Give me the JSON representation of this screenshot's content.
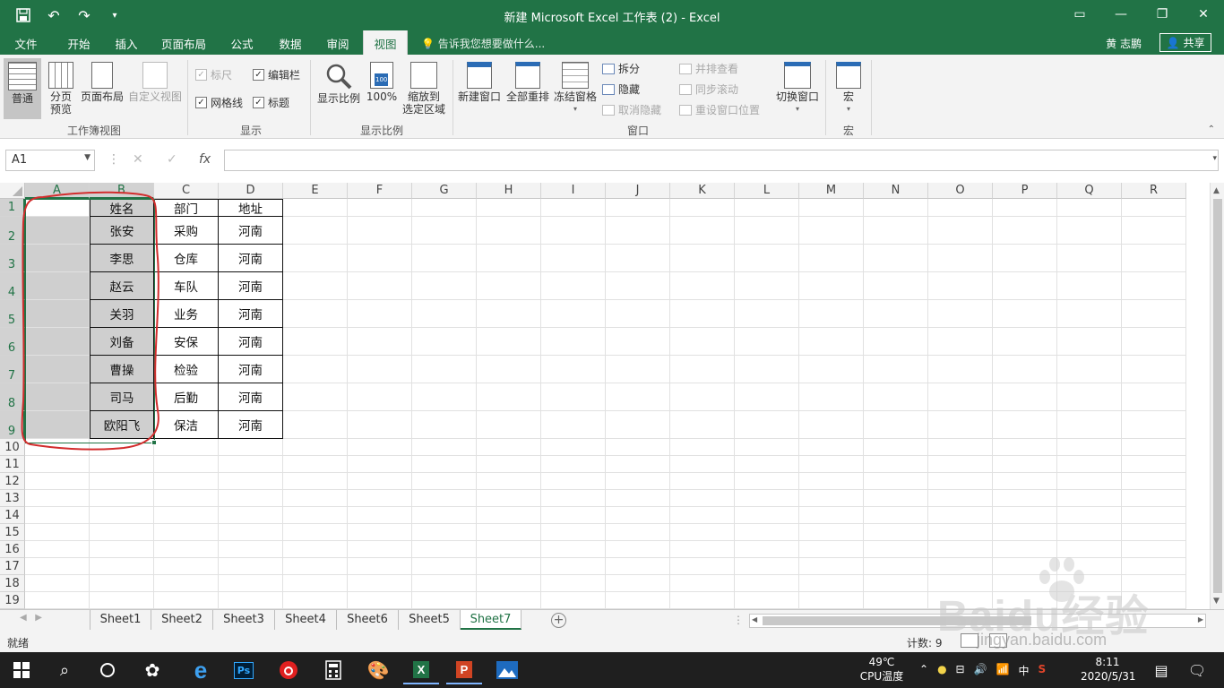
{
  "window": {
    "title": "新建 Microsoft Excel 工作表 (2) - Excel"
  },
  "ribbon_tabs": [
    "文件",
    "开始",
    "插入",
    "页面布局",
    "公式",
    "数据",
    "审阅",
    "视图"
  ],
  "active_tab": "视图",
  "tell_me": "告诉我您想要做什么...",
  "user": "黄 志鹏",
  "share_label": "共享",
  "ribbon": {
    "workbook_views": {
      "label": "工作簿视图",
      "normal": "普通",
      "page_break_1": "分页",
      "page_break_2": "预览",
      "page_layout": "页面布局",
      "custom_views": "自定义视图"
    },
    "show": {
      "label": "显示",
      "ruler": "标尺",
      "formula_bar": "编辑栏",
      "gridlines": "网格线",
      "headings": "标题"
    },
    "zoom": {
      "label": "显示比例",
      "zoom": "显示比例",
      "hundred": "100%",
      "zoom_sel_1": "缩放到",
      "zoom_sel_2": "选定区域",
      "hundred_icon_text": "100"
    },
    "window": {
      "label": "窗口",
      "new_window": "新建窗口",
      "arrange_all": "全部重排",
      "freeze_panes": "冻结窗格",
      "split": "拆分",
      "hide": "隐藏",
      "unhide": "取消隐藏",
      "side_by_side": "并排查看",
      "sync_scroll": "同步滚动",
      "reset_pos": "重设窗口位置",
      "switch_windows": "切换窗口"
    },
    "macros": {
      "label": "宏",
      "macros": "宏"
    }
  },
  "formula_bar": {
    "name_box": "A1",
    "fx": "fx",
    "formula": ""
  },
  "columns": [
    "A",
    "B",
    "C",
    "D",
    "E",
    "F",
    "G",
    "H",
    "I",
    "J",
    "K",
    "L",
    "M",
    "N",
    "O",
    "P",
    "Q",
    "R"
  ],
  "rows": [
    "1",
    "2",
    "3",
    "4",
    "5",
    "6",
    "7",
    "8",
    "9",
    "10",
    "11",
    "12",
    "13",
    "14",
    "15",
    "16",
    "17",
    "18",
    "19"
  ],
  "table": [
    [
      "",
      "姓名",
      "部门",
      "地址"
    ],
    [
      "",
      "张安",
      "采购",
      "河南"
    ],
    [
      "",
      "李思",
      "仓库",
      "河南"
    ],
    [
      "",
      "赵云",
      "车队",
      "河南"
    ],
    [
      "",
      "关羽",
      "业务",
      "河南"
    ],
    [
      "",
      "刘备",
      "安保",
      "河南"
    ],
    [
      "",
      "曹操",
      "检验",
      "河南"
    ],
    [
      "",
      "司马",
      "后勤",
      "河南"
    ],
    [
      "",
      "欧阳飞",
      "保洁",
      "河南"
    ]
  ],
  "sheets": [
    "Sheet1",
    "Sheet2",
    "Sheet3",
    "Sheet4",
    "Sheet6",
    "Sheet5",
    "Sheet7"
  ],
  "active_sheet": "Sheet7",
  "status": {
    "ready": "就绪",
    "count": "计数: 9"
  },
  "taskbar": {
    "temp_value": "49℃",
    "temp_label": "CPU温度",
    "ime": "中",
    "time": "8:11",
    "date": "2020/5/31"
  },
  "watermark": {
    "brand": "Baidu经验",
    "url": "jingyan.baidu.com"
  },
  "colors": {
    "excel_green": "#217346",
    "annotation_red": "#d22d2d"
  }
}
